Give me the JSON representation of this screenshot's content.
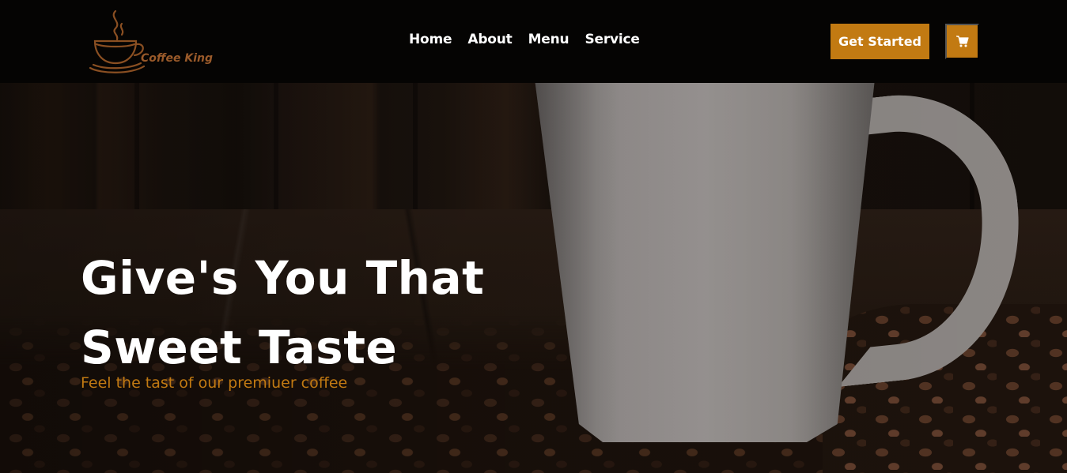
{
  "brand": {
    "name": "Coffee King",
    "accent_color": "#c27a12",
    "logo_icon": "coffee-cup-steam-icon"
  },
  "nav": {
    "items": [
      {
        "label": "Home"
      },
      {
        "label": "About"
      },
      {
        "label": "Menu"
      },
      {
        "label": "Service"
      }
    ]
  },
  "actions": {
    "get_started_label": "Get Started",
    "cart_icon": "shopping-cart-icon"
  },
  "hero": {
    "headline_line1": "Give's You That",
    "headline_line2": "Sweet Taste",
    "subheadline": "Feel the tast of our premiuer coffee",
    "background_image": "white mug with coffee beans on wooden table"
  }
}
